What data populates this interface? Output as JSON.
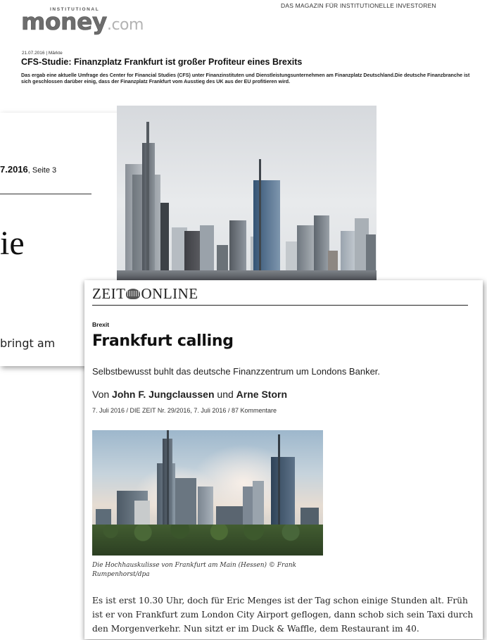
{
  "institutional_money": {
    "tagline": "DAS MAGAZIN FÜR INSTITUTIONELLE INVESTOREN",
    "logo_small": "INSTITUTIONAL",
    "logo_big": "money",
    "logo_domain": ".com",
    "meta": "21.07.2016 | Märkte",
    "title": "CFS-Studie: Finanzplatz Frankfurt ist großer Profiteur eines Brexits",
    "lead": "Das ergab eine aktuelle Umfrage des Center for Financial Studies (CFS) unter Finanzinstituten und Dienstleistungsunternehmen am Finanzplatz Deutschland.Die deutsche Finanzbranche ist sich geschlossen darüber einig, dass der Finanzplatz Frankfurt vom Ausstieg des UK aus der EU profitieren wird."
  },
  "newspaper_clip": {
    "date_fragment": "7.2016",
    "page": ", Seite 3",
    "headline_fragment": "ie",
    "text_fragment": "bringt am"
  },
  "zeit": {
    "logo_left": "ZEIT",
    "logo_right": "ONLINE",
    "kicker": "Brexit",
    "headline": "Frankfurt calling",
    "summary": "Selbstbewusst buhlt das deutsche Finanzzentrum um Londons Banker.",
    "byline_von": "Von ",
    "author1": "John F. Jungclaussen",
    "byline_und": " und ",
    "author2": "Arne Storn",
    "meta": "7. Juli 2016  /  DIE ZEIT Nr. 29/2016, 7. Juli 2016  /  87 Kommentare",
    "caption": "Die Hochhauskulisse von Frankfurt am Main (Hessen) © Frank Rumpenhorst/dpa",
    "body": "Es ist erst 10.30 Uhr, doch für Eric Menges ist der Tag schon einige Stunden alt. Früh ist er von Frankfurt zum London City Airport geflogen, dann schob sich sein Taxi durch den Morgenverkehr. Nun sitzt er im Duck & Waffle, dem Restaurant im 40."
  }
}
